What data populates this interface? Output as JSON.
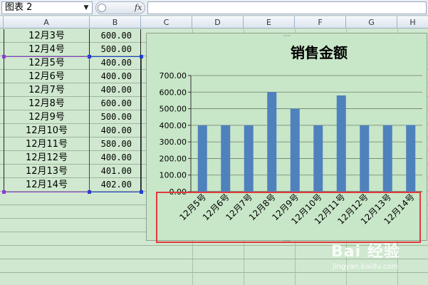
{
  "formula_bar": {
    "name_box": "图表 2",
    "fx_label": "fx",
    "formula_value": ""
  },
  "columns": [
    "A",
    "B",
    "C",
    "D",
    "E",
    "F",
    "G",
    "H"
  ],
  "rows": [
    {
      "date": "12月3号",
      "amount": "600.00"
    },
    {
      "date": "12月4号",
      "amount": "500.00"
    },
    {
      "date": "12月5号",
      "amount": "400.00"
    },
    {
      "date": "12月6号",
      "amount": "400.00"
    },
    {
      "date": "12月7号",
      "amount": "400.00"
    },
    {
      "date": "12月8号",
      "amount": "600.00"
    },
    {
      "date": "12月9号",
      "amount": "500.00"
    },
    {
      "date": "12月10号",
      "amount": "400.00"
    },
    {
      "date": "12月11号",
      "amount": "580.00"
    },
    {
      "date": "12月12号",
      "amount": "400.00"
    },
    {
      "date": "12月13号",
      "amount": "401.00"
    },
    {
      "date": "12月14号",
      "amount": "402.00"
    }
  ],
  "chart_data": {
    "type": "bar",
    "title": "销售金额",
    "categories": [
      "12月5号",
      "12月6号",
      "12月7号",
      "12月8号",
      "12月9号",
      "12月10号",
      "12月11号",
      "12月12号",
      "12月13号",
      "12月14号"
    ],
    "values": [
      400,
      400,
      400,
      600,
      500,
      400,
      580,
      400,
      401,
      402
    ],
    "ylim": [
      0,
      700
    ],
    "yticks": [
      "0.00",
      "100.00",
      "200.00",
      "300.00",
      "400.00",
      "500.00",
      "600.00",
      "700.00"
    ],
    "grid": true,
    "bar_color": "#4f81bd"
  },
  "colors": {
    "selection": "#1f3fd1",
    "highlight_box": "#e03b3b",
    "sheet_background": "#cfe8cf"
  },
  "watermark": {
    "logo": "Bai 经验",
    "url": "jingyan.baidu.com"
  }
}
